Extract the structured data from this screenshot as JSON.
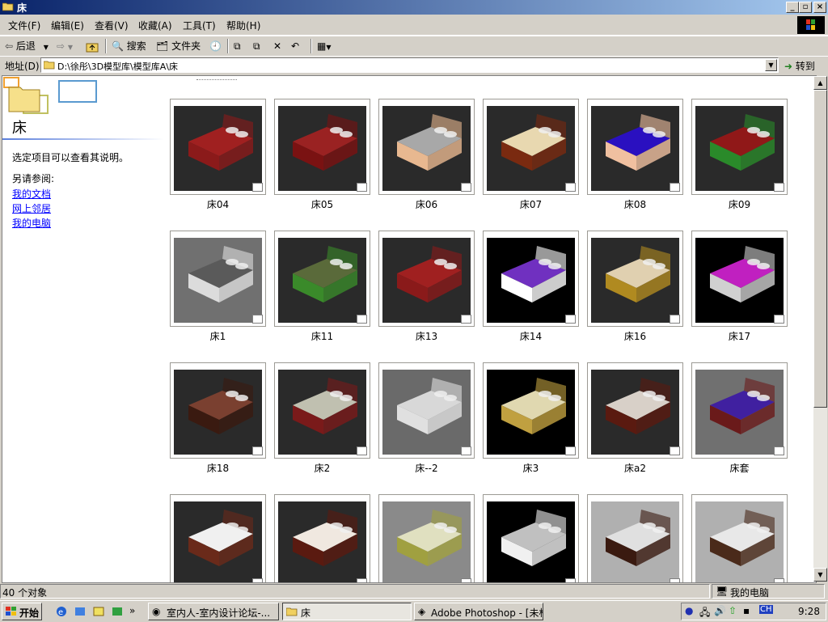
{
  "window": {
    "title": "床"
  },
  "menu": [
    "文件(F)",
    "编辑(E)",
    "查看(V)",
    "收藏(A)",
    "工具(T)",
    "帮助(H)"
  ],
  "toolbar": {
    "back": "后退",
    "search": "搜索",
    "folders": "文件夹"
  },
  "address": {
    "label": "地址(D)",
    "path": "D:\\徐彤\\3D模型库\\模型库A\\床",
    "go": "转到"
  },
  "left_panel": {
    "title": "床",
    "description": "选定项目可以查看其说明。",
    "see_also": "另请参阅:",
    "links": [
      "我的文档",
      "网上邻居",
      "我的电脑"
    ]
  },
  "thumbnails": [
    {
      "label": "床04",
      "bg": "#2a2a2a",
      "bed": "#8b1a1a",
      "sheet": "#a02020"
    },
    {
      "label": "床05",
      "bg": "#2a2a2a",
      "bed": "#7a1212",
      "sheet": "#9a2222"
    },
    {
      "label": "床06",
      "bg": "#2a2a2a",
      "bed": "#e8b890",
      "sheet": "#a8a8a8"
    },
    {
      "label": "床07",
      "bg": "#2a2a2a",
      "bed": "#7a2a10",
      "sheet": "#e8d8b0"
    },
    {
      "label": "床08",
      "bg": "#2a2a2a",
      "bed": "#f0c0a0",
      "sheet": "#2a10c0"
    },
    {
      "label": "床09",
      "bg": "#2a2a2a",
      "bed": "#2a8a2a",
      "sheet": "#901818"
    },
    {
      "label": "床1",
      "bg": "#707070",
      "bed": "#dcdcdc",
      "sheet": "#5a5a5a"
    },
    {
      "label": "床11",
      "bg": "#2a2a2a",
      "bed": "#3a8a2a",
      "sheet": "#5a6a3a"
    },
    {
      "label": "床13",
      "bg": "#2a2a2a",
      "bed": "#8a1a1a",
      "sheet": "#a02020"
    },
    {
      "label": "床14",
      "bg": "#000000",
      "bed": "#ffffff",
      "sheet": "#7030c0"
    },
    {
      "label": "床16",
      "bg": "#2a2a2a",
      "bed": "#b08a20",
      "sheet": "#e0d0b0"
    },
    {
      "label": "床17",
      "bg": "#000000",
      "bed": "#d0d0d0",
      "sheet": "#c020c0"
    },
    {
      "label": "床18",
      "bg": "#2a2a2a",
      "bed": "#3a1a10",
      "sheet": "#7a4030"
    },
    {
      "label": "床2",
      "bg": "#2a2a2a",
      "bed": "#7a1a1a",
      "sheet": "#c0c0b0"
    },
    {
      "label": "床--2",
      "bg": "#6a6a6a",
      "bed": "#e0e0e0",
      "sheet": "#d8d8d8"
    },
    {
      "label": "床3",
      "bg": "#000000",
      "bed": "#c0a040",
      "sheet": "#e0d8b0"
    },
    {
      "label": "床a2",
      "bg": "#2a2a2a",
      "bed": "#5a1a10",
      "sheet": "#d8d0c8"
    },
    {
      "label": "床套",
      "bg": "#707070",
      "bed": "#6a1a1a",
      "sheet": "#4020a0"
    },
    {
      "label": "",
      "bg": "#2a2a2a",
      "bed": "#6a2a1a",
      "sheet": "#f0f0f0"
    },
    {
      "label": "",
      "bg": "#2a2a2a",
      "bed": "#5a1a10",
      "sheet": "#f0e8e0"
    },
    {
      "label": "",
      "bg": "#8a8a8a",
      "bed": "#a0a040",
      "sheet": "#e0e0c0"
    },
    {
      "label": "",
      "bg": "#000000",
      "bed": "#f0f0f0",
      "sheet": "#c0c0c0"
    },
    {
      "label": "",
      "bg": "#b0b0b0",
      "bed": "#3a1a10",
      "sheet": "#e0e0e0"
    },
    {
      "label": "",
      "bg": "#b0b0b0",
      "bed": "#4a2a1a",
      "sheet": "#e8e8e8"
    }
  ],
  "status": {
    "count": "40 个对象",
    "location": "我的电脑"
  },
  "taskbar": {
    "start": "开始",
    "buttons": [
      "室内人-室内设计论坛-...",
      "床",
      "Adobe Photoshop - [未标..."
    ],
    "lang": "CH",
    "time": "9:28"
  }
}
